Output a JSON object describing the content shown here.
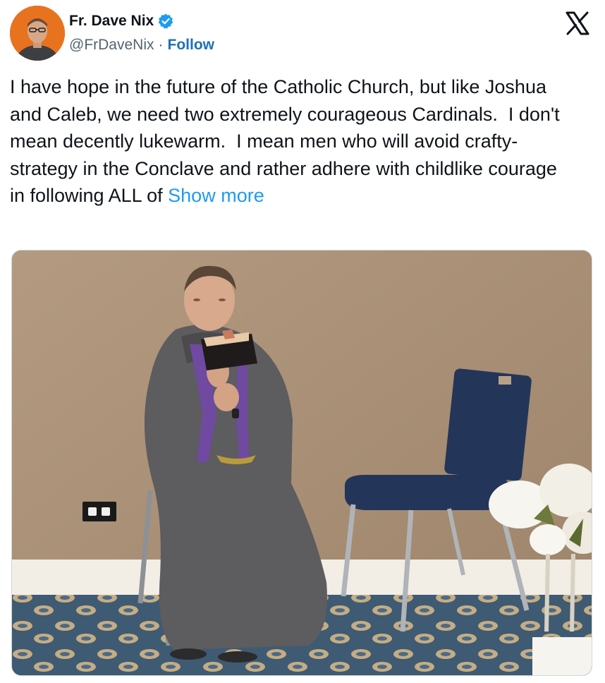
{
  "author": {
    "display_name": "Fr. Dave Nix",
    "handle": "@FrDaveNix",
    "separator": "·",
    "follow_label": "Follow",
    "verified": true
  },
  "icons": {
    "avatar": "avatar-photo",
    "verified": "verified-badge-icon",
    "platform": "x-logo-icon"
  },
  "colors": {
    "link": "#1d9bf0",
    "follow": "#1d70b8",
    "verified": "#1d9bf0",
    "avatar_bg": "#e8731f"
  },
  "tweet": {
    "text": "I have hope in the future of the Catholic Church, but like Joshua and Caleb, we need two extremely courageous Cardinals.  I don't mean decently lukewarm.  I mean men who will avoid crafty-strategy in the Conclave and rather adhere with childlike courage in following ALL of ",
    "show_more_label": "Show more"
  }
}
